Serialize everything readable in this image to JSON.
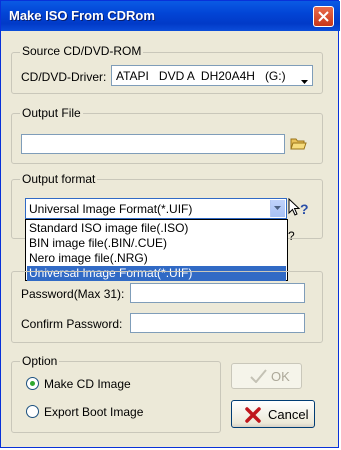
{
  "window": {
    "title": "Make ISO From CDRom"
  },
  "source": {
    "group_label": "Source CD/DVD-ROM",
    "driver_label": "CD/DVD-Driver:",
    "driver_value": "ATAPI   DVD A  DH20A4H   (G:)"
  },
  "output_file": {
    "group_label": "Output File",
    "value": ""
  },
  "output_format": {
    "group_label": "Output format",
    "selected": "Universal Image Format(*.UIF)",
    "options": [
      "Standard ISO image file(.ISO)",
      "BIN image file(.BIN/.CUE)",
      "Nero image file(.NRG)",
      "Universal Image Format(*.UIF)"
    ],
    "help_glyph": "?"
  },
  "password": {
    "password_label": "Password(Max 31):",
    "confirm_label": "Confirm Password:",
    "password_value": "",
    "confirm_value": ""
  },
  "option": {
    "group_label": "Option",
    "make_cd_image": "Make CD Image",
    "export_boot_image": "Export Boot Image",
    "selected": "make_cd_image"
  },
  "buttons": {
    "ok_label": "OK",
    "cancel_label": "Cancel"
  },
  "icons": {
    "close": "close-icon",
    "folder": "folder-icon",
    "help": "help-cursor-icon",
    "check": "check-icon",
    "cancel": "cancel-x-icon"
  },
  "colors": {
    "titlebar": "#0245d6",
    "dialog_bg": "#ece9d8",
    "selection": "#316ac5",
    "close_button": "#c9361a",
    "cancel_x": "#c0161d"
  }
}
